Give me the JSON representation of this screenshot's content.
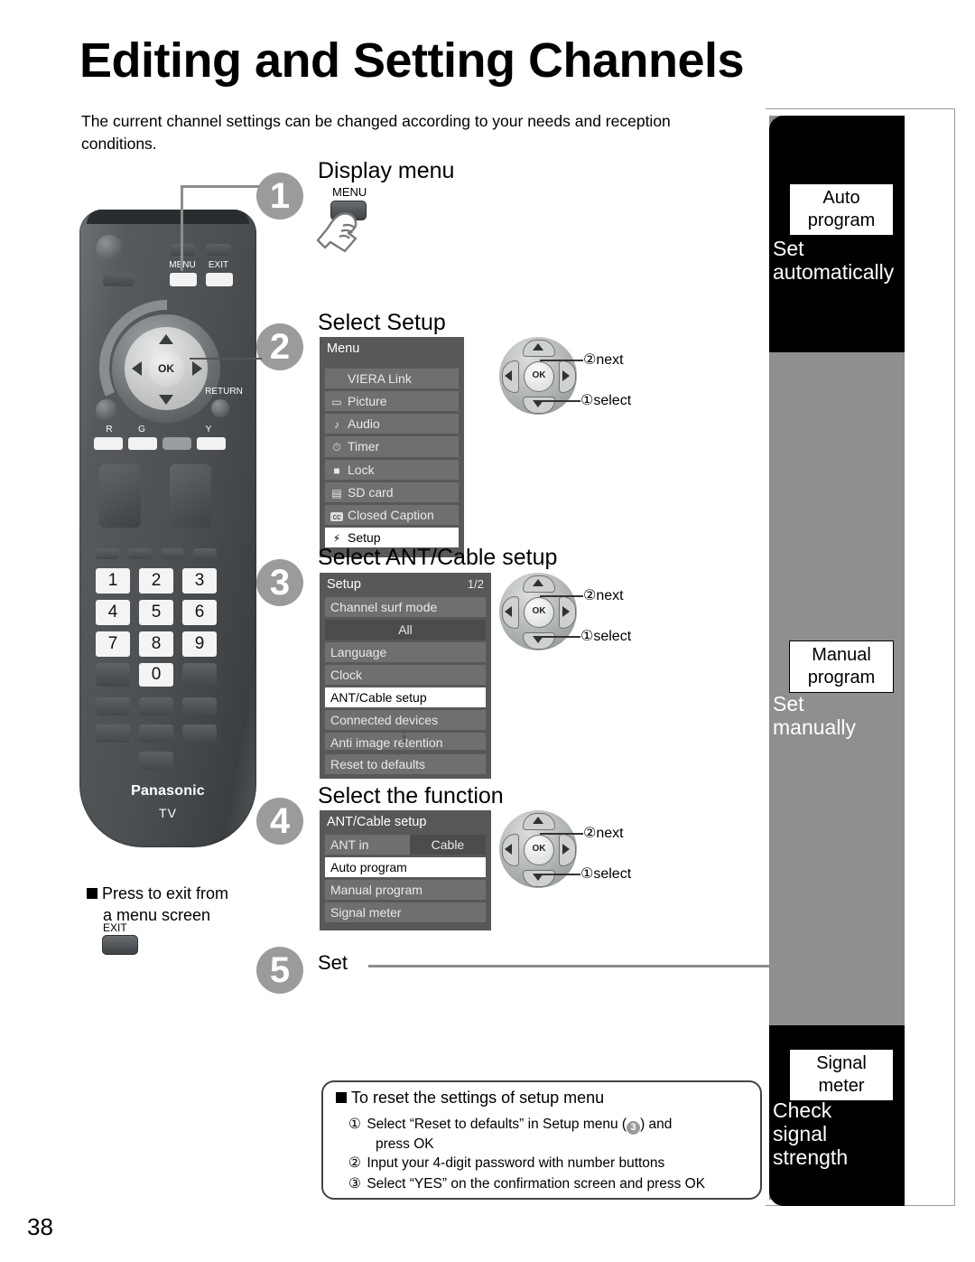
{
  "page": {
    "title": "Editing and Setting Channels",
    "intro": "The current channel settings can be changed according to your needs and reception conditions.",
    "number": "38"
  },
  "steps": [
    {
      "num": "1",
      "label": "Display menu"
    },
    {
      "num": "2",
      "label": "Select  Setup"
    },
    {
      "num": "3",
      "label": "Select  ANT/Cable setup"
    },
    {
      "num": "4",
      "label": "Select the function"
    },
    {
      "num": "5",
      "label": "Set"
    }
  ],
  "remote": {
    "menu_label": "MENU",
    "exit_label": "EXIT",
    "return_label": "RETURN",
    "ok_label": "OK",
    "color_keys": [
      "R",
      "G",
      "",
      "Y"
    ],
    "numbers": [
      "1",
      "2",
      "3",
      "4",
      "5",
      "6",
      "7",
      "8",
      "9",
      "0"
    ],
    "brand": "Panasonic",
    "device": "TV"
  },
  "callouts": {
    "menu_button_label": "MENU",
    "exit_button_label": "EXIT",
    "exit_note_line1": "Press to exit from",
    "exit_note_line2": "a menu screen"
  },
  "navpad": {
    "next": "②next",
    "select": "①select",
    "ok": "OK"
  },
  "osd_menu": {
    "title": "Menu",
    "rows": [
      {
        "icon": "",
        "label": "VIERA Link",
        "selected": false
      },
      {
        "icon": "▭",
        "label": "Picture",
        "selected": false
      },
      {
        "icon": "♪",
        "label": "Audio",
        "selected": false
      },
      {
        "icon": "⏱",
        "label": "Timer",
        "selected": false
      },
      {
        "icon": "■",
        "label": "Lock",
        "selected": false
      },
      {
        "icon": "▤",
        "label": "SD card",
        "selected": false
      },
      {
        "icon": "cc",
        "label": "Closed Caption",
        "selected": false
      },
      {
        "icon": "⚡",
        "label": "Setup",
        "selected": true
      }
    ]
  },
  "osd_setup": {
    "title": "Setup",
    "page": "1/2",
    "rows": [
      {
        "label": "Channel surf mode",
        "type": "row",
        "selected": false
      },
      {
        "label": "All",
        "type": "value",
        "selected": false
      },
      {
        "label": "Language",
        "type": "row",
        "selected": false
      },
      {
        "label": "Clock",
        "type": "row",
        "selected": false
      },
      {
        "label": "ANT/Cable setup",
        "type": "row",
        "selected": true
      },
      {
        "label": "Connected devices",
        "type": "row",
        "selected": false
      },
      {
        "label": "Anti image retention",
        "type": "row",
        "selected": false
      }
    ],
    "more_indicator": "▼",
    "footer_row": "Reset to defaults"
  },
  "osd_ant": {
    "title": "ANT/Cable setup",
    "split_row": {
      "left": "ANT in",
      "right": "Cable"
    },
    "rows": [
      {
        "label": "Auto program",
        "selected": true
      },
      {
        "label": "Manual program",
        "selected": false
      },
      {
        "label": "Signal meter",
        "selected": false
      }
    ]
  },
  "sidebar": [
    {
      "chip_line1": "Auto",
      "chip_line2": "program",
      "caption_line1": "Set",
      "caption_line2": "automatically",
      "background": "#000000"
    },
    {
      "chip_line1": "Manual",
      "chip_line2": "program",
      "caption_line1": "Set",
      "caption_line2": "manually",
      "background": "#8f8f8f"
    },
    {
      "chip_line1": "Signal",
      "chip_line2": "meter",
      "caption_line1": "Check",
      "caption_line2": "signal",
      "caption_line3": "strength",
      "background": "#000000"
    }
  ],
  "notebox": {
    "heading": "To reset the settings of setup menu",
    "items": [
      {
        "num": "①",
        "text_before": "Select “Reset to defaults” in Setup menu (",
        "badge": "3",
        "text_after": ") and",
        "text_line2": "press OK"
      },
      {
        "num": "②",
        "text_before": "Input your 4-digit password with number buttons",
        "badge": "",
        "text_after": "",
        "text_line2": ""
      },
      {
        "num": "③",
        "text_before": "Select “YES” on the confirmation screen and press OK",
        "badge": "",
        "text_after": "",
        "text_line2": ""
      }
    ]
  },
  "colors": {
    "step_circle": "#9b9b9b",
    "osd_bg": "#58585a",
    "osd_row": "#6f6f71",
    "osd_selected": "#ffffff",
    "sidebar_gray": "#8f8f8f",
    "sidebar_black": "#000000"
  }
}
